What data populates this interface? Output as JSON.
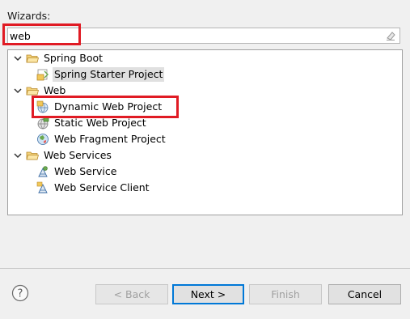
{
  "wizards_label": "Wizards:",
  "filter": {
    "value": "web"
  },
  "tree": {
    "spring_boot": {
      "label": "Spring Boot",
      "children": [
        "Spring Starter Project"
      ]
    },
    "web": {
      "label": "Web",
      "children": [
        "Dynamic Web Project",
        "Static Web Project",
        "Web Fragment Project"
      ]
    },
    "web_services": {
      "label": "Web Services",
      "children": [
        "Web Service",
        "Web Service Client"
      ]
    }
  },
  "buttons": {
    "back": "< Back",
    "next": "Next >",
    "finish": "Finish",
    "cancel": "Cancel"
  },
  "colors": {
    "highlight": "#e01b24",
    "folder": "#e8b84a",
    "default_button_border": "#0078d7"
  }
}
